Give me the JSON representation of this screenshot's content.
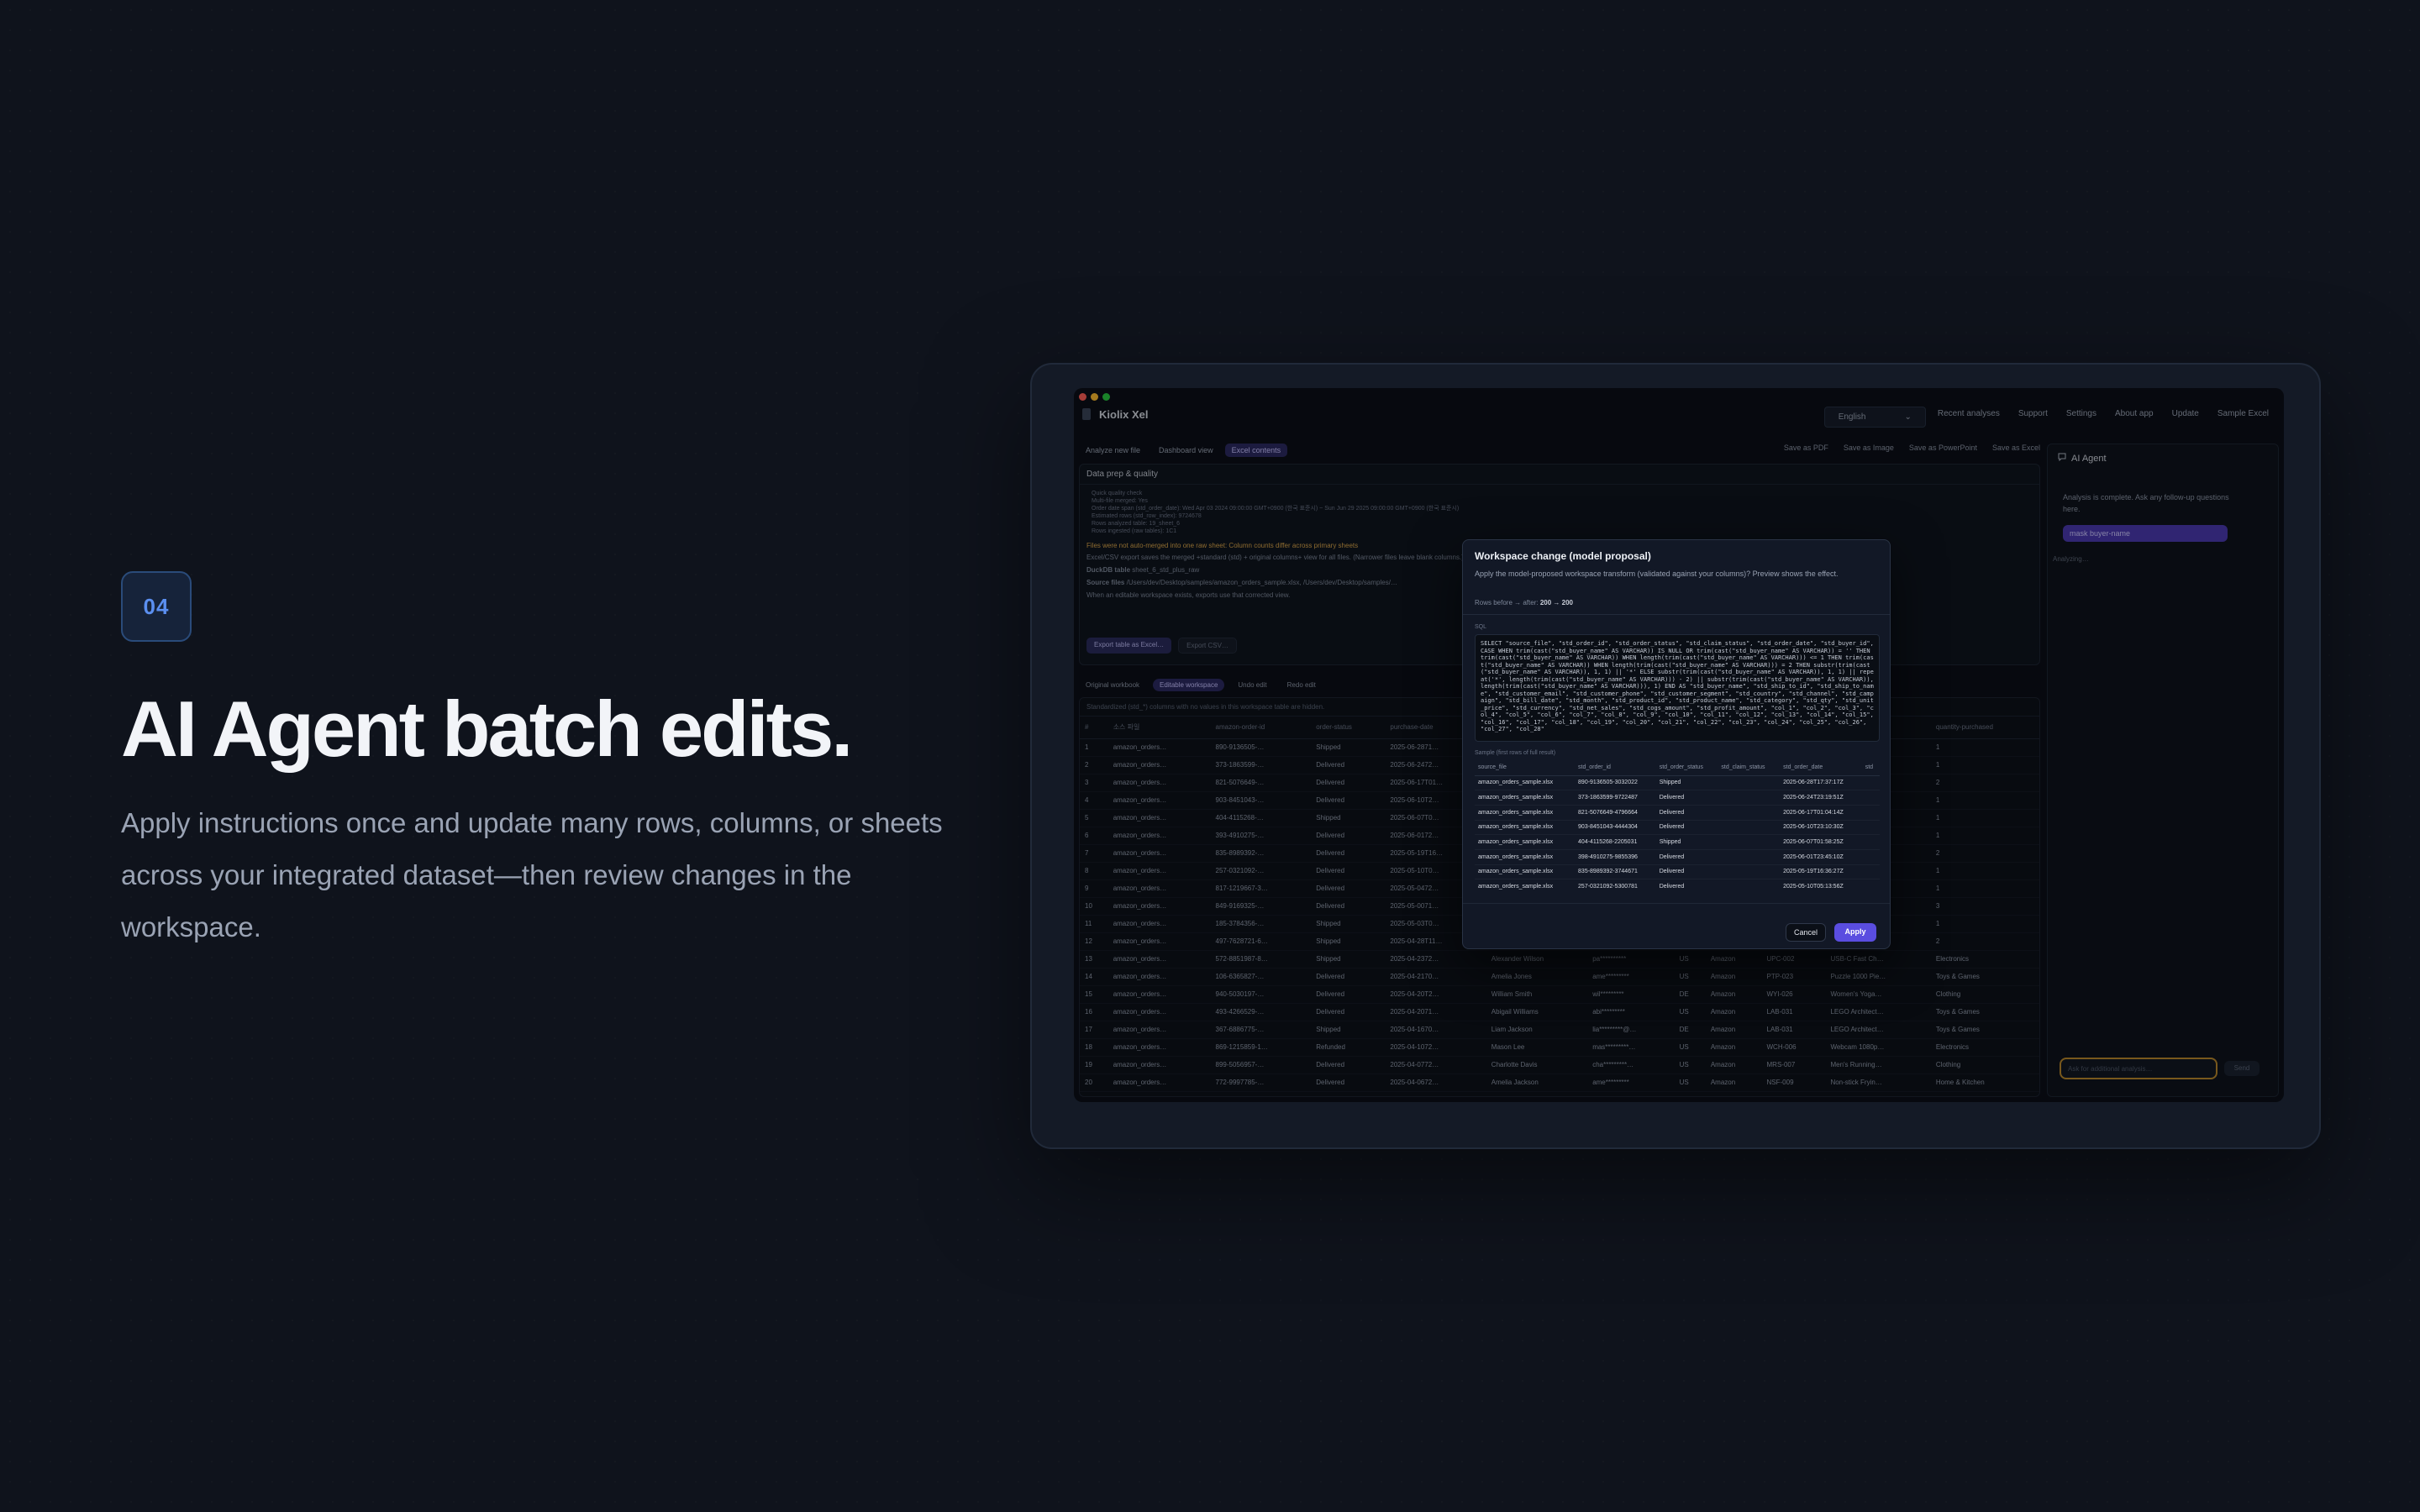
{
  "hero": {
    "step": "04",
    "title": "AI Agent batch edits.",
    "subtitle": "Apply instructions once and update many rows, columns, or sheets across your integrated dataset—then review changes in the workspace."
  },
  "app": {
    "name": "Kiolix Xel",
    "language": "English",
    "language_caret": "⌄",
    "topnav": [
      "Recent analyses",
      "Support",
      "Settings",
      "About app",
      "Update",
      "Sample Excel"
    ],
    "tabs": [
      "Analyze new file",
      "Dashboard view",
      "Excel contents"
    ],
    "active_tab": "Excel contents",
    "exports": [
      "Save as PDF",
      "Save as Image",
      "Save as PowerPoint",
      "Save as Excel"
    ],
    "colors": {
      "accent": "#5a4de0",
      "warning": "#d9a54a",
      "close": "#ff5f57",
      "minimize": "#febc2e",
      "maximize": "#28c840"
    }
  },
  "data_prep": {
    "title": "Data prep & quality",
    "lines": [
      "Quick quality check",
      "Multi-file merged: Yes",
      "Order date span (std_order_date): Wed Apr 03 2024 09:00:00 GMT+0900 (한국 표준시) ~ Sun Jun 29 2025 09:00:00 GMT+0900 (한국 표준시)",
      "Estimated rows (std_row_index): 9724678",
      "Rows analyzed table: 19_sheet_6",
      "Rows ingested (raw tables): 1C1"
    ],
    "warning": "Files were not auto-merged into one raw sheet: Column counts differ across primary sheets",
    "note1": "Excel/CSV export saves the merged +standard (std) + original columns+ view for all files. (Narrower files leave blank columns.)",
    "duckdb_label": "DuckDB table",
    "duckdb_value": "sheet_6_std_plus_raw",
    "source_label": "Source files",
    "source_value": "/Users/dev/Desktop/samples/amazon_orders_sample.xlsx, /Users/dev/Desktop/samples/…",
    "note2": "When an editable workspace exists, exports use that corrected view.",
    "export_excel": "Export table as Excel…",
    "export_csv": "Export CSV…"
  },
  "workspace": {
    "tabs": [
      "Original workbook",
      "Editable workspace",
      "Undo edit",
      "Redo edit"
    ],
    "active": "Editable workspace",
    "note": "Standardized (std_*) columns with no values in this workspace table are hidden.",
    "columns": [
      "#",
      "소스 파일",
      "amazon-order-id",
      "order-status",
      "purchase-date",
      "buyer-name",
      "",
      "",
      "",
      "",
      "category",
      "quantity-purchased"
    ],
    "rows": [
      [
        "1",
        "amazon_orders…",
        "890-9136505-…",
        "Shipped",
        "2025-06-2871…",
        "Ava Miller",
        "",
        "",
        "",
        "",
        "Beauty & Perso…",
        "1"
      ],
      [
        "2",
        "amazon_orders…",
        "373-1863599-…",
        "Delivered",
        "2025-06-2472…",
        "Liam Davis",
        "",
        "",
        "",
        "",
        "Electronics",
        "1"
      ],
      [
        "3",
        "amazon_orders…",
        "821-5076649-…",
        "Delivered",
        "2025-06-17T01…",
        "Charlotte Martin",
        "",
        "",
        "",
        "",
        "Electronics",
        "2"
      ],
      [
        "4",
        "amazon_orders…",
        "903-8451043-…",
        "Delivered",
        "2025-06-10T2…",
        "Mia Williams",
        "",
        "",
        "",
        "",
        "Sports & Outdo…",
        "1"
      ],
      [
        "5",
        "amazon_orders…",
        "404-4115268-…",
        "Shipped",
        "2025-06-07T0…",
        "Sophia Williams",
        "",
        "",
        "",
        "",
        "Clothing",
        "1"
      ],
      [
        "6",
        "amazon_orders…",
        "393-4910275-…",
        "Delivered",
        "2025-06-0172…",
        "Henry Hernandez",
        "",
        "",
        "",
        "",
        "Books",
        "1"
      ],
      [
        "7",
        "amazon_orders…",
        "835-8989392-…",
        "Delivered",
        "2025-05-19T16…",
        "Emma Williams",
        "",
        "",
        "",
        "",
        "Beauty & Perso…",
        "2"
      ],
      [
        "8",
        "amazon_orders…",
        "257-0321092-…",
        "Delivered",
        "2025-05-10T0…",
        "William Moore",
        "",
        "",
        "",
        "",
        "Toys & Games",
        "1"
      ],
      [
        "9",
        "amazon_orders…",
        "817-1219667-3…",
        "Delivered",
        "2025-05-0472…",
        "Charlotte Davis",
        "",
        "",
        "",
        "",
        "Books",
        "1"
      ],
      [
        "10",
        "amazon_orders…",
        "849-9169325-…",
        "Delivered",
        "2025-05-0071…",
        "William Garcia",
        "",
        "",
        "",
        "",
        "Sports & Outdo…",
        "3"
      ],
      [
        "11",
        "amazon_orders…",
        "185-3784356-…",
        "Shipped",
        "2025-05-03T0…",
        "Sophia White",
        "",
        "",
        "",
        "",
        "Clothing",
        "1"
      ],
      [
        "12",
        "amazon_orders…",
        "497-7628721-6…",
        "Shipped",
        "2025-04-28T11…",
        "Mason Thomas",
        "",
        "",
        "",
        "",
        "Sports & Outdo…",
        "2"
      ],
      [
        "13",
        "amazon_orders…",
        "572-8851987-8…",
        "Shipped",
        "2025-04-2372…",
        "Alexander Wilson",
        "pa**********",
        "US",
        "Amazon",
        "UPC-002",
        "USB-C Fast Ch…",
        "Electronics",
        "4"
      ],
      [
        "14",
        "amazon_orders…",
        "106-6365827-…",
        "Delivered",
        "2025-04-2170…",
        "Amelia Jones",
        "ame*********",
        "US",
        "Amazon",
        "PTP-023",
        "Puzzle 1000 Pie…",
        "Toys & Games",
        "3"
      ],
      [
        "15",
        "amazon_orders…",
        "940-5030197-…",
        "Delivered",
        "2025-04-20T2…",
        "William Smith",
        "wil*********",
        "DE",
        "Amazon",
        "WYI-026",
        "Women's Yoga…",
        "Clothing",
        "1"
      ],
      [
        "16",
        "amazon_orders…",
        "493-4266529-…",
        "Delivered",
        "2025-04-2071…",
        "Abigail Williams",
        "abi*********",
        "US",
        "Amazon",
        "LAB-031",
        "LEGO Architect…",
        "Toys & Games",
        "1"
      ],
      [
        "17",
        "amazon_orders…",
        "367-6886775-…",
        "Shipped",
        "2025-04-1670…",
        "Liam Jackson",
        "lia*********@…",
        "DE",
        "Amazon",
        "LAB-031",
        "LEGO Architect…",
        "Toys & Games",
        "2"
      ],
      [
        "18",
        "amazon_orders…",
        "869-1215859-1…",
        "Refunded",
        "2025-04-1072…",
        "Mason Lee",
        "mas*********…",
        "US",
        "Amazon",
        "WCH-006",
        "Webcam 1080p…",
        "Electronics",
        "1"
      ],
      [
        "19",
        "amazon_orders…",
        "899-5056957-…",
        "Delivered",
        "2025-04-0772…",
        "Charlotte Davis",
        "cha*********…",
        "US",
        "Amazon",
        "MRS-007",
        "Men's Running…",
        "Clothing",
        "1"
      ],
      [
        "20",
        "amazon_orders…",
        "772-9997785-…",
        "Delivered",
        "2025-04-0672…",
        "Amelia Jackson",
        "ame*********",
        "US",
        "Amazon",
        "NSF-009",
        "Non-stick Fryin…",
        "Home & Kitchen",
        "1"
      ]
    ]
  },
  "agent": {
    "title": "AI Agent",
    "message": "Analysis is complete. Ask any follow-up questions here.",
    "chip": "mask buyer-name",
    "status": "Analyzing…",
    "input_placeholder": "Ask for additional analysis…",
    "send": "Send"
  },
  "modal": {
    "title": "Workspace change (model proposal)",
    "desc": "Apply the model-proposed workspace transform (validated against your columns)? Preview shows the effect.",
    "rows_label": "Rows before → after:",
    "rows_value": "200 → 200",
    "sql_label": "SQL",
    "sql": "SELECT \"source_file\", \"std_order_id\", \"std_order_status\", \"std_claim_status\", \"std_order_date\", \"std_buyer_id\", CASE WHEN trim(cast(\"std_buyer_name\" AS VARCHAR)) IS NULL OR trim(cast(\"std_buyer_name\" AS VARCHAR)) = '' THEN trim(cast(\"std_buyer_name\" AS VARCHAR)) WHEN length(trim(cast(\"std_buyer_name\" AS VARCHAR))) <= 1 THEN trim(cast(\"std_buyer_name\" AS VARCHAR)) WHEN length(trim(cast(\"std_buyer_name\" AS VARCHAR))) = 2 THEN substr(trim(cast(\"std_buyer_name\" AS VARCHAR)), 1, 1) || '*' ELSE substr(trim(cast(\"std_buyer_name\" AS VARCHAR)), 1, 1) || repeat('*', length(trim(cast(\"std_buyer_name\" AS VARCHAR))) - 2) || substr(trim(cast(\"std_buyer_name\" AS VARCHAR)), length(trim(cast(\"std_buyer_name\" AS VARCHAR))), 1) END AS \"std_buyer_name\", \"std_ship_to_id\", \"std_ship_to_name\", \"std_customer_email\", \"std_customer_phone\", \"std_customer_segment\", \"std_country\", \"std_channel\", \"std_campaign\", \"std_bill_date\", \"std_month\", \"std_product_id\", \"std_product_name\", \"std_category\", \"std_qty\", \"std_unit_price\", \"std_currency\", \"std_net_sales\", \"std_cogs_amount\", \"std_profit_amount\", \"col_1\", \"col_2\", \"col_3\", \"col_4\", \"col_5\", \"col_6\", \"col_7\", \"col_8\", \"col_9\", \"col_10\", \"col_11\", \"col_12\", \"col_13\", \"col_14\", \"col_15\", \"col_16\", \"col_17\", \"col_18\", \"col_19\", \"col_20\", \"col_21\", \"col_22\", \"col_23\", \"col_24\", \"col_25\", \"col_26\", \"col_27\", \"col_28\"",
    "sample_label": "Sample (first rows of full result)",
    "sample_columns": [
      "source_file",
      "std_order_id",
      "std_order_status",
      "std_claim_status",
      "std_order_date",
      "std"
    ],
    "sample_rows": [
      [
        "amazon_orders_sample.xlsx",
        "890-9136505-3032022",
        "Shipped",
        "",
        "2025-06-28T17:37:17Z",
        ""
      ],
      [
        "amazon_orders_sample.xlsx",
        "373-1863599-9722487",
        "Delivered",
        "",
        "2025-06-24T23:19:51Z",
        ""
      ],
      [
        "amazon_orders_sample.xlsx",
        "821-5076649-4796664",
        "Delivered",
        "",
        "2025-06-17T01:04:14Z",
        ""
      ],
      [
        "amazon_orders_sample.xlsx",
        "903-8451043-4444304",
        "Delivered",
        "",
        "2025-06-10T23:10:30Z",
        ""
      ],
      [
        "amazon_orders_sample.xlsx",
        "404-4115268-2205031",
        "Shipped",
        "",
        "2025-06-07T01:58:25Z",
        ""
      ],
      [
        "amazon_orders_sample.xlsx",
        "398-4910275-9855396",
        "Delivered",
        "",
        "2025-06-01T23:45:10Z",
        ""
      ],
      [
        "amazon_orders_sample.xlsx",
        "835-8989392-3744671",
        "Delivered",
        "",
        "2025-05-19T16:36:27Z",
        ""
      ],
      [
        "amazon_orders_sample.xlsx",
        "257-0321092-5300781",
        "Delivered",
        "",
        "2025-05-10T05:13:56Z",
        ""
      ]
    ],
    "cancel": "Cancel",
    "apply": "Apply"
  }
}
